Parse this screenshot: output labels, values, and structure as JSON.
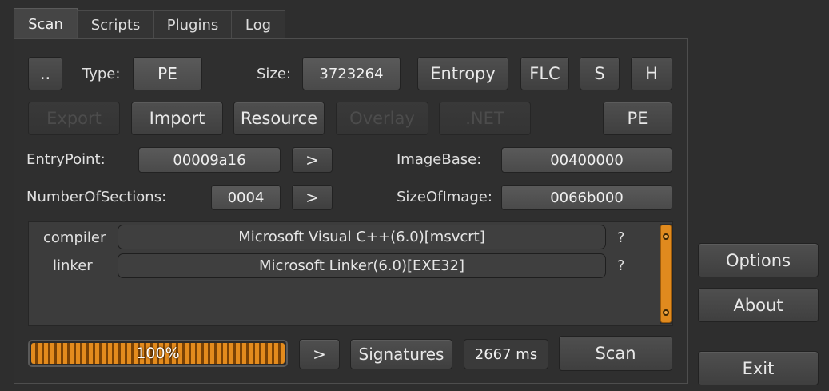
{
  "tabs": [
    "Scan",
    "Scripts",
    "Plugins",
    "Log"
  ],
  "row1": {
    "up_button": "..",
    "type_label": "Type:",
    "type_value": "PE",
    "size_label": "Size:",
    "size_value": "3723264",
    "entropy_button": "Entropy",
    "flc_button": "FLC",
    "s_button": "S",
    "h_button": "H"
  },
  "row2": {
    "export_button": "Export",
    "import_button": "Import",
    "resource_button": "Resource",
    "overlay_button": "Overlay",
    "net_button": ".NET",
    "pe_button": "PE"
  },
  "header": {
    "entrypoint_label": "EntryPoint:",
    "entrypoint_value": "00009a16",
    "entrypoint_go": ">",
    "imagebase_label": "ImageBase:",
    "imagebase_value": "00400000",
    "sections_label": "NumberOfSections:",
    "sections_value": "0004",
    "sections_go": ">",
    "sizeofimage_label": "SizeOfImage:",
    "sizeofimage_value": "0066b000"
  },
  "detections": [
    {
      "type": "compiler",
      "name": "Microsoft Visual C++(6.0)[msvcrt]",
      "info": "?"
    },
    {
      "type": "linker",
      "name": "Microsoft Linker(6.0)[EXE32]",
      "info": "?"
    }
  ],
  "bottom": {
    "progress_percent": 100,
    "progress_text": "100%",
    "next_button": ">",
    "signatures_button": "Signatures",
    "time_value": "2667 ms",
    "scan_button": "Scan"
  },
  "side": {
    "options_button": "Options",
    "about_button": "About",
    "exit_button": "Exit"
  },
  "colors": {
    "accent": "#e38b1d",
    "background": "#2e2e2e"
  }
}
